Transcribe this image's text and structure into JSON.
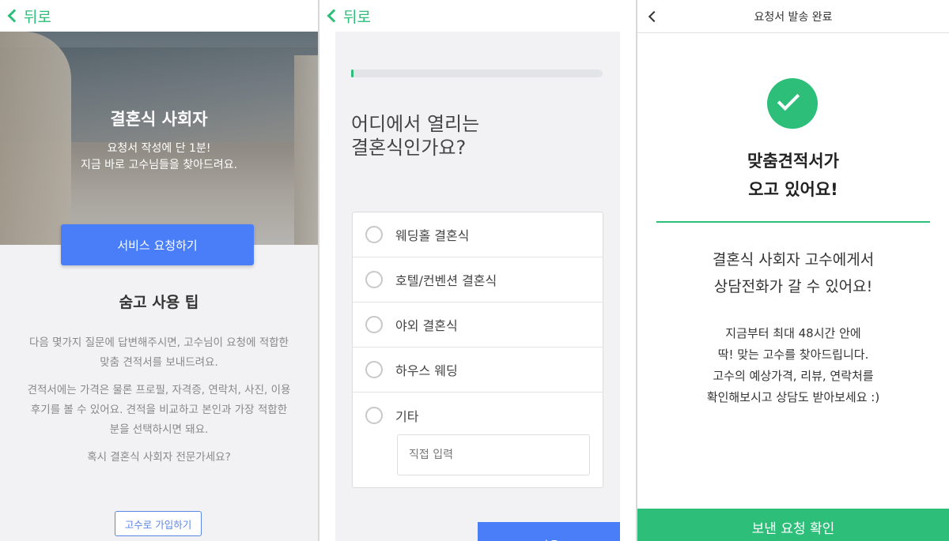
{
  "panel1": {
    "back_label": "뒤로",
    "hero_title": "결혼식 사회자",
    "hero_sub_line1": "요청서 작성에 단 1분!",
    "hero_sub_line2": "지금 바로 고수님들을 찾아드려요.",
    "service_button": "서비스 요청하기",
    "tips_title": "숨고 사용 팁",
    "tip1_line1": "다음 몇가지 질문에 답변해주시면, 고수님이 요청에 적합한",
    "tip1_line2": "맞춤 견적서를 보내드려요.",
    "tip2_line1": "견적서에는 가격은 물론 프로필, 자격증, 연락처, 사진, 이용",
    "tip2_line2": "후기를 볼 수 있어요. 견적을 비교하고 본인과 가장 적합한",
    "tip2_line3": "분을 선택하시면 돼요.",
    "tip3": "혹시 결혼식 사회자 전문가세요?",
    "join_button": "고수로 가입하기"
  },
  "panel2": {
    "back_label": "뒤로",
    "progress": 0.01,
    "question_line1": "어디에서 열리는",
    "question_line2": "결혼식인가요?",
    "options": [
      {
        "label": "웨딩홀 결혼식"
      },
      {
        "label": "호텔/컨벤션 결혼식"
      },
      {
        "label": "야외 결혼식"
      },
      {
        "label": "하우스 웨딩"
      },
      {
        "label": "기타"
      }
    ],
    "direct_placeholder": "직접 입력",
    "next_button": "다음"
  },
  "panel3": {
    "header_title": "요청서 발송 완료",
    "headline_line1": "맞춤견적서가",
    "headline_line2": "오고 있어요!",
    "msg_line1": "결혼식 사회자 고수에게서",
    "msg_line2": "상담전화가 갈 수 있어요!",
    "info_line1": "지금부터 최대 48시간 안에",
    "info_line2": "딱! 맞는 고수를 찾아드립니다.",
    "info_line3": "고수의 예상가격, 리뷰, 연락처를",
    "info_line4": "확인해보시고 상담도 받아보세요 :)",
    "confirm_button": "보낸 요청 확인"
  },
  "colors": {
    "brand_green": "#2dbf7a",
    "brand_blue": "#4a7ef8"
  }
}
